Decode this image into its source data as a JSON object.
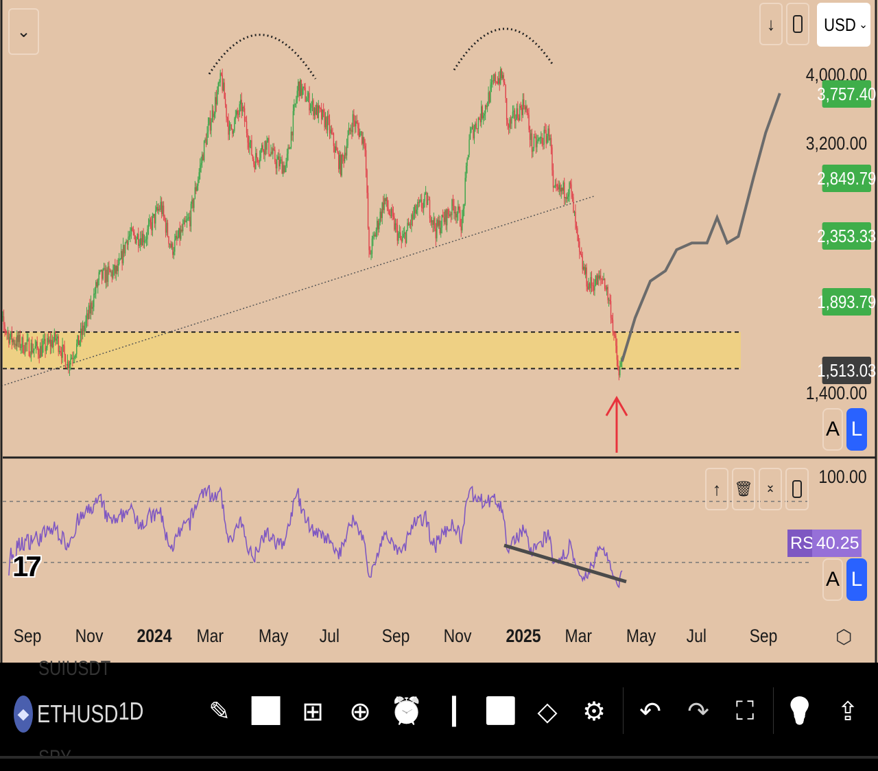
{
  "header": {
    "currency": "USD",
    "collapse_icon": "chevron-down-icon"
  },
  "price_axis": {
    "labels": [
      "4,000.00",
      "3,200.00",
      "1,400.00"
    ],
    "tags": [
      {
        "value": "3,757.40",
        "color": "#3fae4a"
      },
      {
        "value": "2,849.79",
        "color": "#3fae4a"
      },
      {
        "value": "2,353.33",
        "color": "#3fae4a"
      },
      {
        "value": "1,893.79",
        "color": "#3fae4a"
      },
      {
        "value": "1,513.03",
        "color": "#3d3d3d"
      }
    ]
  },
  "scale_buttons": {
    "auto": "A",
    "log": "L"
  },
  "rsi": {
    "name": "RSI",
    "value": "40.25",
    "top_label": "100.00"
  },
  "time_axis": [
    "Sep",
    "Nov",
    "2024",
    "Mar",
    "May",
    "Jul",
    "Sep",
    "Nov",
    "2025",
    "Mar",
    "May",
    "Jul",
    "Sep"
  ],
  "bottom_bar": {
    "symbol": "ETHUSD",
    "interval": "1D",
    "prev_symbol": "SUIUSDT",
    "next_symbol": "SPY"
  },
  "colors": {
    "up": "#3aa64a",
    "down": "#e0404a",
    "zone": "#f0d27e",
    "background": "#e3c4a8",
    "rsi": "#7e57c2",
    "projection": "#6b6b6b"
  },
  "chart_data": {
    "type": "candlestick",
    "title": "ETHUSD 1D",
    "yscale": "log",
    "ylim": [
      1250,
      4400
    ],
    "price_anchors": [
      [
        "2023-08-01",
        1850
      ],
      [
        "2023-08-17",
        1680
      ],
      [
        "2023-09-01",
        1640
      ],
      [
        "2023-09-15",
        1620
      ],
      [
        "2023-10-01",
        1680
      ],
      [
        "2023-10-12",
        1550
      ],
      [
        "2023-10-22",
        1650
      ],
      [
        "2023-11-01",
        1800
      ],
      [
        "2023-11-12",
        2050
      ],
      [
        "2023-12-01",
        2100
      ],
      [
        "2023-12-10",
        2350
      ],
      [
        "2023-12-28",
        2350
      ],
      [
        "2024-01-12",
        2600
      ],
      [
        "2024-01-23",
        2250
      ],
      [
        "2024-02-10",
        2500
      ],
      [
        "2024-02-25",
        3200
      ],
      [
        "2024-03-12",
        3950
      ],
      [
        "2024-03-20",
        3300
      ],
      [
        "2024-04-01",
        3600
      ],
      [
        "2024-04-13",
        3000
      ],
      [
        "2024-04-25",
        3200
      ],
      [
        "2024-05-05",
        3000
      ],
      [
        "2024-05-15",
        2950
      ],
      [
        "2024-05-27",
        3850
      ],
      [
        "2024-06-10",
        3600
      ],
      [
        "2024-06-25",
        3400
      ],
      [
        "2024-07-08",
        2950
      ],
      [
        "2024-07-20",
        3450
      ],
      [
        "2024-08-01",
        3200
      ],
      [
        "2024-08-05",
        2200
      ],
      [
        "2024-08-20",
        2650
      ],
      [
        "2024-09-06",
        2300
      ],
      [
        "2024-09-20",
        2550
      ],
      [
        "2024-10-01",
        2650
      ],
      [
        "2024-10-10",
        2400
      ],
      [
        "2024-10-28",
        2600
      ],
      [
        "2024-11-05",
        2450
      ],
      [
        "2024-11-12",
        3250
      ],
      [
        "2024-11-28",
        3600
      ],
      [
        "2024-12-08",
        3950
      ],
      [
        "2024-12-16",
        3950
      ],
      [
        "2024-12-20",
        3350
      ],
      [
        "2025-01-06",
        3650
      ],
      [
        "2025-01-13",
        3150
      ],
      [
        "2025-01-31",
        3300
      ],
      [
        "2025-02-03",
        2700
      ],
      [
        "2025-02-20",
        2750
      ],
      [
        "2025-03-01",
        2200
      ],
      [
        "2025-03-10",
        2000
      ],
      [
        "2025-03-25",
        2050
      ],
      [
        "2025-04-01",
        1850
      ],
      [
        "2025-04-09",
        1480
      ],
      [
        "2025-04-12",
        1580
      ]
    ],
    "projection": [
      [
        "2025-04-12",
        1560
      ],
      [
        "2025-04-25",
        1800
      ],
      [
        "2025-05-10",
        2030
      ],
      [
        "2025-05-25",
        2100
      ],
      [
        "2025-06-05",
        2250
      ],
      [
        "2025-06-20",
        2300
      ],
      [
        "2025-07-05",
        2300
      ],
      [
        "2025-07-15",
        2500
      ],
      [
        "2025-07-25",
        2300
      ],
      [
        "2025-08-05",
        2350
      ],
      [
        "2025-08-20",
        2850
      ],
      [
        "2025-09-01",
        3300
      ],
      [
        "2025-09-15",
        3757
      ]
    ],
    "support_zone": [
      1524,
      1718
    ],
    "trendline": [
      [
        "2023-08-01",
        1430
      ],
      [
        "2025-03-15",
        2680
      ]
    ],
    "rsi_levels": [
      70,
      30
    ],
    "rsi_divergence": [
      [
        "2024-12-20",
        37
      ],
      [
        "2025-04-10",
        26
      ]
    ],
    "annotations": [
      "double-top arcs",
      "support zone",
      "red up arrow at 2025-04-09",
      "RSI bullish divergence line"
    ]
  }
}
